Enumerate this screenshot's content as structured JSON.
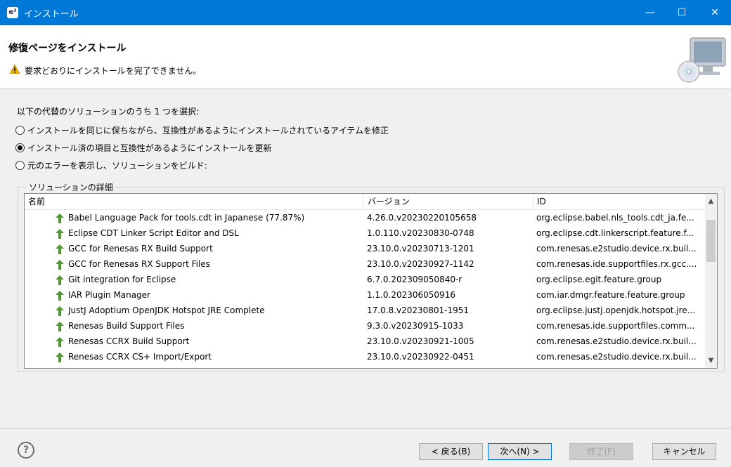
{
  "window": {
    "title": "インストール",
    "app_icon": "e²",
    "minimize": "—",
    "maximize": "☐",
    "close": "✕"
  },
  "header": {
    "title": "修復ページをインストール",
    "message": "要求どおりにインストールを完了できません。"
  },
  "prompt": "以下の代替のソリューションのうち 1 つを選択:",
  "options": [
    {
      "label": "インストールを同じに保ちながら、互換性があるようにインストールされているアイテムを修正",
      "selected": false
    },
    {
      "label": "インストール済の項目と互換性があるようにインストールを更新",
      "selected": true
    },
    {
      "label": "元のエラーを表示し、ソリューションをビルド:",
      "selected": false
    }
  ],
  "details": {
    "group_label": "ソリューションの詳細",
    "columns": [
      "名前",
      "バージョン",
      "ID"
    ],
    "rows": [
      {
        "name": "Babel Language Pack for tools.cdt in Japanese (77.87%)",
        "version": "4.26.0.v20230220105658",
        "id": "org.eclipse.babel.nls_tools.cdt_ja.fe..."
      },
      {
        "name": "Eclipse CDT Linker Script Editor and DSL",
        "version": "1.0.110.v20230830-0748",
        "id": "org.eclipse.cdt.linkerscript.feature.f..."
      },
      {
        "name": "GCC for Renesas RX Build Support",
        "version": "23.10.0.v20230713-1201",
        "id": "com.renesas.e2studio.device.rx.buil..."
      },
      {
        "name": "GCC for Renesas RX Support Files",
        "version": "23.10.0.v20230927-1142",
        "id": "com.renesas.ide.supportfiles.rx.gcc...."
      },
      {
        "name": "Git integration for Eclipse",
        "version": "6.7.0.202309050840-r",
        "id": "org.eclipse.egit.feature.group"
      },
      {
        "name": "IAR Plugin Manager",
        "version": "1.1.0.202306050916",
        "id": "com.iar.dmgr.feature.feature.group"
      },
      {
        "name": "JustJ Adoptium OpenJDK Hotspot JRE Complete",
        "version": "17.0.8.v20230801-1951",
        "id": "org.eclipse.justj.openjdk.hotspot.jre..."
      },
      {
        "name": "Renesas Build Support Files",
        "version": "9.3.0.v20230915-1033",
        "id": "com.renesas.ide.supportfiles.comm..."
      },
      {
        "name": "Renesas CCRX Build Support",
        "version": "23.10.0.v20230921-1005",
        "id": "com.renesas.e2studio.device.rx.buil..."
      },
      {
        "name": "Renesas CCRX CS+ Import/Export",
        "version": "23.10.0.v20230922-0451",
        "id": "com.renesas.e2studio.device.rx.buil..."
      }
    ]
  },
  "buttons": {
    "help": "?",
    "back": "< 戻る(B)",
    "next": "次へ(N) >",
    "finish": "終了(F)",
    "cancel": "キャンセル"
  },
  "icons": {
    "warning": "warning-icon",
    "update": "green-up-arrow-icon",
    "banner": "install-computer-icon"
  },
  "colors": {
    "titlebar": "#0078d7",
    "update_arrow": "#4e9a2e",
    "warning": "#f0b400"
  }
}
